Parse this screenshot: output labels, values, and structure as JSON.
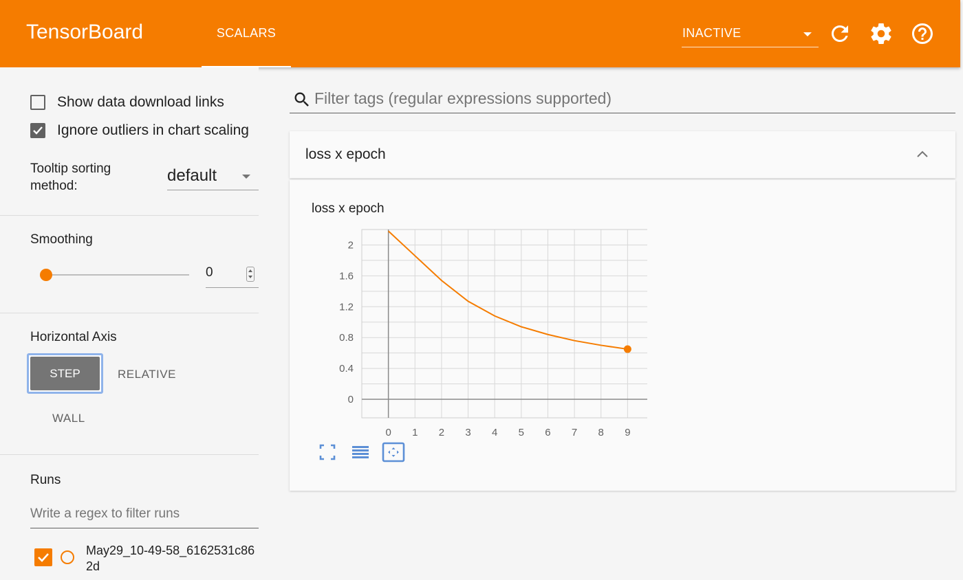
{
  "header": {
    "logo": "TensorBoard",
    "tab_label": "SCALARS",
    "status": "INACTIVE",
    "icons": [
      "refresh-icon",
      "gear-icon",
      "help-icon"
    ],
    "accent_color": "#f57c00"
  },
  "sidebar": {
    "show_download_label": "Show data download links",
    "show_download_checked": false,
    "ignore_outliers_label": "Ignore outliers in chart scaling",
    "ignore_outliers_checked": true,
    "tooltip_label": "Tooltip sorting method:",
    "tooltip_value": "default",
    "smoothing_title": "Smoothing",
    "smoothing_value": "0",
    "smoothing_fraction": 0,
    "axis_title": "Horizontal Axis",
    "axis_options": [
      "STEP",
      "RELATIVE",
      "WALL"
    ],
    "axis_selected": "STEP",
    "runs_title": "Runs",
    "runs_filter_placeholder": "Write a regex to filter runs",
    "runs": [
      {
        "name": "May29_10-49-58_6162531c862d",
        "checked": true,
        "color": "#f57c00"
      }
    ]
  },
  "main": {
    "filter_placeholder": "Filter tags (regular expressions supported)",
    "card_title": "loss x epoch",
    "tool_icons": [
      "fit-domain-icon",
      "log-scale-icon",
      "zoom-region-icon"
    ]
  },
  "chart_data": {
    "type": "line",
    "title": "loss x epoch",
    "xlabel": "",
    "ylabel": "",
    "x": [
      0,
      1,
      2,
      3,
      4,
      5,
      6,
      7,
      8,
      9
    ],
    "series": [
      {
        "values": [
          2.18,
          1.86,
          1.54,
          1.27,
          1.08,
          0.94,
          0.84,
          0.76,
          0.7,
          0.65
        ],
        "color": "#f57c00"
      }
    ],
    "xticks": [
      0,
      1,
      2,
      3,
      4,
      5,
      6,
      7,
      8,
      9
    ],
    "yticks": [
      0,
      0.4,
      0.8,
      1.2,
      1.6,
      2
    ],
    "xlim": [
      -1,
      10
    ],
    "ylim": [
      -0.24,
      2.2
    ],
    "grid": true
  }
}
